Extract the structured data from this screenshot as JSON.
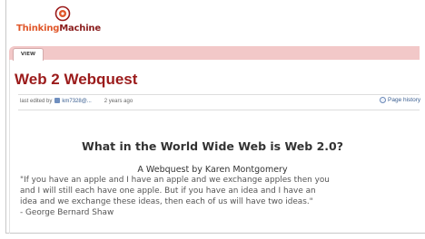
{
  "logo": {
    "text_part1": "Thinking",
    "text_part2": "Machine"
  },
  "tabs": [
    {
      "label": "VIEW"
    }
  ],
  "page": {
    "title": "Web 2 Webquest",
    "meta": {
      "prefix": "last edited by",
      "user": "km7328@...",
      "time": "2 years ago"
    },
    "history_link": "Page history"
  },
  "content": {
    "heading": "What in the World Wide Web is Web 2.0?",
    "subheading": "A Webquest by Karen Montgomery",
    "quote_lines": [
      "\"If you have an apple and I have an apple and we exchange apples then you",
      "and I will still each have one apple. But if you have an idea and I have an",
      "idea and we exchange these ideas, then each of us will have two ideas.\"",
      "- George Bernard Shaw"
    ]
  },
  "colors": {
    "title": "#9b1b1b",
    "tab_bar": "#f2c8c8",
    "link": "#3b5f91",
    "logo_orange": "#e0572a"
  },
  "icons": {
    "logo": "gear-logo-icon",
    "user": "user-icon",
    "history": "page-history-icon"
  }
}
